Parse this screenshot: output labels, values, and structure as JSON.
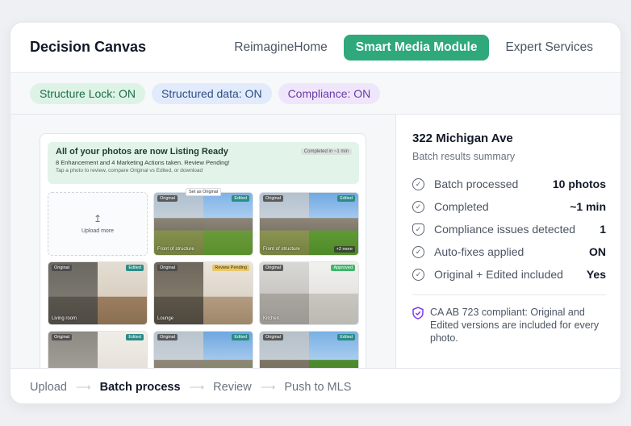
{
  "header": {
    "brand": "Decision Canvas",
    "nav": [
      {
        "label": "ReimagineHome",
        "active": false
      },
      {
        "label": "Smart Media Module",
        "active": true
      },
      {
        "label": "Expert Services",
        "active": false
      }
    ]
  },
  "pills": [
    {
      "label": "Structure Lock: ON",
      "color": "green"
    },
    {
      "label": "Structured data: ON",
      "color": "blue"
    },
    {
      "label": "Compliance: ON",
      "color": "purple"
    }
  ],
  "preview": {
    "banner_title": "All of your photos are now Listing Ready",
    "banner_sub": "8 Enhancement and 4 Marketing Actions taken. Review Pending!",
    "banner_hint": "Tap a photo to review, compare Original vs Edited, or download",
    "banner_chip": "Completed in ~1 min",
    "upload_label": "Upload more",
    "set_original": "Set as Original",
    "tiles": [
      {
        "orig": "Original",
        "badge": "Edited",
        "caption": "Front of structure",
        "more": ""
      },
      {
        "orig": "Original",
        "badge": "Edited",
        "caption": "Front of structure",
        "more": "+2 more"
      },
      {
        "orig": "Original",
        "badge": "Edited",
        "caption": "Living room",
        "more": ""
      },
      {
        "orig": "Original",
        "badge": "Review Pending",
        "caption": "Lounge",
        "more": ""
      },
      {
        "orig": "Original",
        "badge": "Approved",
        "caption": "Kitchen",
        "more": ""
      },
      {
        "orig": "Original",
        "badge": "Edited",
        "caption": "",
        "more": ""
      },
      {
        "orig": "Original",
        "badge": "Edited",
        "caption": "",
        "more": ""
      },
      {
        "orig": "Original",
        "badge": "Edited",
        "caption": "",
        "more": ""
      }
    ]
  },
  "summary": {
    "address": "322 Michigan Ave",
    "subtitle": "Batch results summary",
    "stats": [
      {
        "label": "Batch processed",
        "value": "10 photos",
        "icon": "check-circle-icon"
      },
      {
        "label": "Completed",
        "value": "~1 min",
        "icon": "check-circle-icon"
      },
      {
        "label": "Compliance issues detected",
        "value": "1",
        "icon": "shield-check-icon"
      },
      {
        "label": "Auto-fixes applied",
        "value": "ON",
        "icon": "check-circle-icon"
      },
      {
        "label": "Original + Edited included",
        "value": "Yes",
        "icon": "check-circle-icon"
      }
    ],
    "note": "CA AB 723 compliant: Original and Edited versions are included for every photo."
  },
  "footer": {
    "steps": [
      {
        "label": "Upload",
        "active": false
      },
      {
        "label": "Batch process",
        "active": true
      },
      {
        "label": "Review",
        "active": false
      },
      {
        "label": "Push to MLS",
        "active": false
      }
    ]
  }
}
